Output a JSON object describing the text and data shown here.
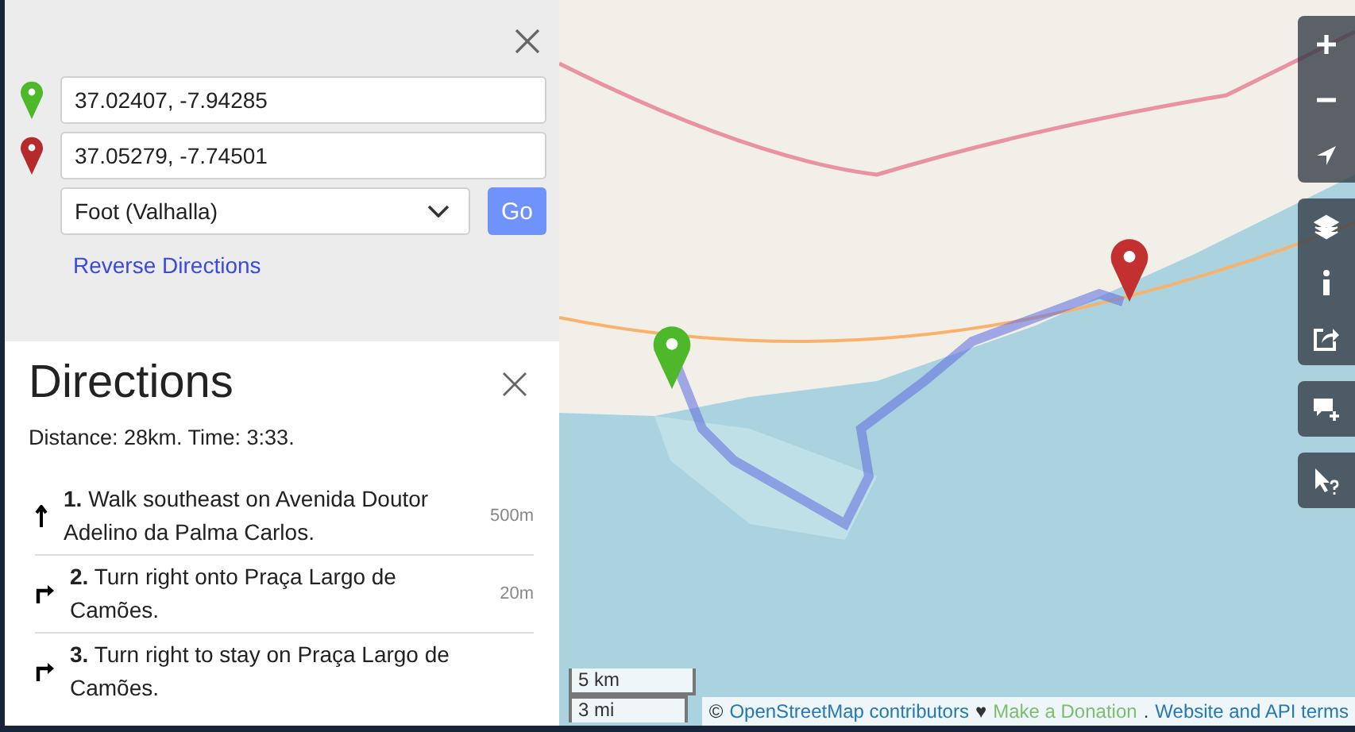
{
  "route_form": {
    "from": "37.02407, -7.94285",
    "to": "37.05279, -7.74501",
    "engine": "Foot (Valhalla)",
    "go": "Go",
    "reverse": "Reverse Directions"
  },
  "directions": {
    "title": "Directions",
    "summary": "Distance: 28km. Time: 3:33.",
    "steps": [
      {
        "kind": "straight",
        "number": "1.",
        "text": "Walk southeast on Avenida Doutor Adelino da Palma Carlos.",
        "distance": "500m"
      },
      {
        "kind": "right",
        "number": "2.",
        "text": "Turn right onto Praça Largo de Camões.",
        "distance": "20m"
      },
      {
        "kind": "right",
        "number": "3.",
        "text": "Turn right to stay on Praça Largo de Camões."
      }
    ]
  },
  "map": {
    "scale": [
      "5 km",
      "3 mi"
    ],
    "attribution": [
      {
        "kind": "plain",
        "text": "©"
      },
      {
        "kind": "link",
        "text": "OpenStreetMap contributors"
      },
      {
        "kind": "plain",
        "text": "♥"
      },
      {
        "kind": "donate",
        "text": "Make a Donation"
      },
      {
        "kind": "plain",
        "text": "."
      },
      {
        "kind": "link",
        "text": "Website and API terms"
      }
    ]
  }
}
